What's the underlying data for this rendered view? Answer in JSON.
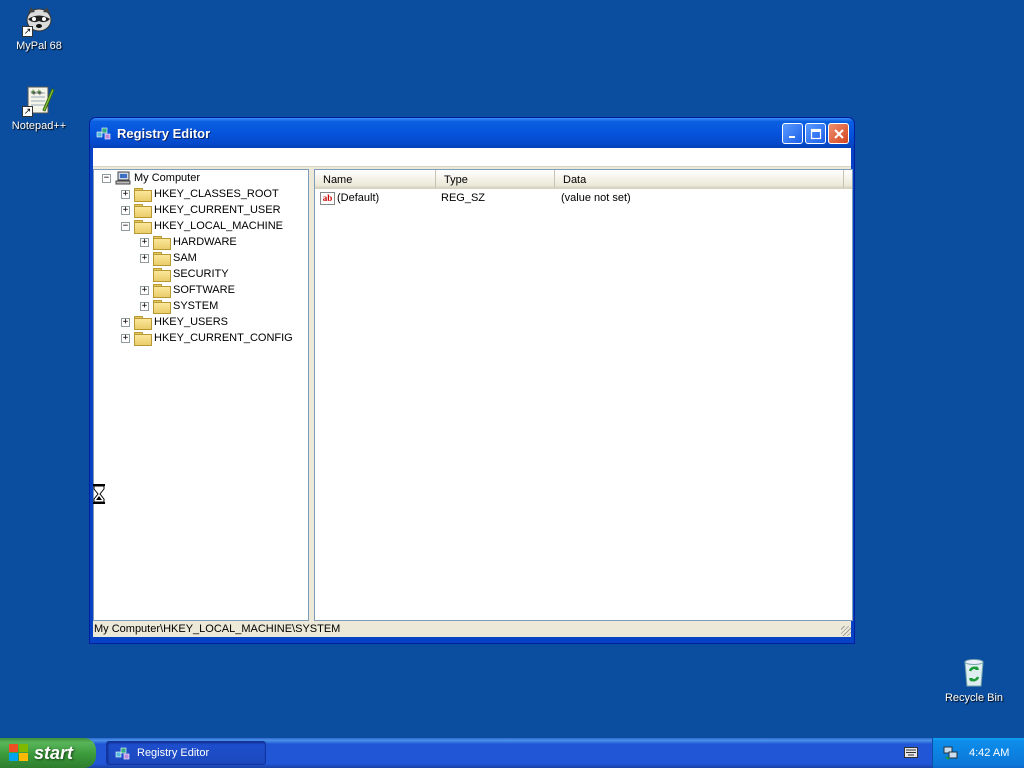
{
  "desktop": {
    "icons": [
      {
        "label": "MyPal 68"
      },
      {
        "label": "Notepad++"
      },
      {
        "label": "Recycle Bin"
      }
    ]
  },
  "window": {
    "title": "Registry Editor",
    "tree": {
      "root": "My Computer",
      "nodes": [
        {
          "label": "HKEY_CLASSES_ROOT",
          "expander": "+"
        },
        {
          "label": "HKEY_CURRENT_USER",
          "expander": "+"
        },
        {
          "label": "HKEY_LOCAL_MACHINE",
          "expander": "−"
        },
        {
          "label": "HARDWARE",
          "expander": "+"
        },
        {
          "label": "SAM",
          "expander": "+"
        },
        {
          "label": "SECURITY",
          "expander": ""
        },
        {
          "label": "SOFTWARE",
          "expander": "+"
        },
        {
          "label": "SYSTEM",
          "expander": "+"
        },
        {
          "label": "HKEY_USERS",
          "expander": "+"
        },
        {
          "label": "HKEY_CURRENT_CONFIG",
          "expander": "+"
        }
      ],
      "root_expander": "−"
    },
    "list": {
      "columns": [
        "Name",
        "Type",
        "Data"
      ],
      "rows": [
        {
          "icon": "ab",
          "name": "(Default)",
          "type": "REG_SZ",
          "data": "(value not set)"
        }
      ]
    },
    "status": "My Computer\\HKEY_LOCAL_MACHINE\\SYSTEM"
  },
  "taskbar": {
    "start_label": "start",
    "task_label": "Registry Editor",
    "clock": "4:42 AM"
  },
  "colors": {
    "desktop": "#0b4e9f",
    "title_bar": "#0554dd",
    "close_button": "#d2451f",
    "start_button": "#3a9a3a",
    "tray": "#0b77d8"
  }
}
